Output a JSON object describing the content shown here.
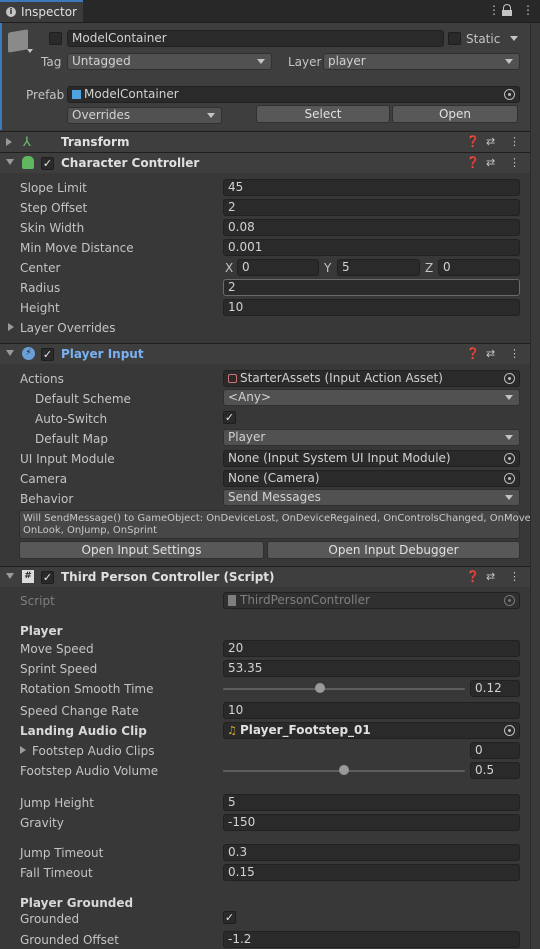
{
  "tab": {
    "title": "Inspector"
  },
  "object": {
    "name": "ModelContainer",
    "static_label": "Static",
    "tag_label": "Tag",
    "tag_value": "Untagged",
    "layer_label": "Layer",
    "layer_value": "player"
  },
  "prefab": {
    "label": "Prefab",
    "asset": "ModelContainer",
    "overrides": "Overrides",
    "select": "Select",
    "open": "Open"
  },
  "transform": {
    "title": "Transform"
  },
  "cc": {
    "title": "Character Controller",
    "slope_label": "Slope Limit",
    "slope": "45",
    "step_label": "Step Offset",
    "step": "2",
    "skin_label": "Skin Width",
    "skin": "0.08",
    "minmove_label": "Min Move Distance",
    "minmove": "0.001",
    "center_label": "Center",
    "cx_l": "X",
    "cx": "0",
    "cy_l": "Y",
    "cy": "5",
    "cz_l": "Z",
    "cz": "0",
    "radius_label": "Radius",
    "radius": "2",
    "height_label": "Height",
    "height": "10",
    "overrides_label": "Layer Overrides"
  },
  "pi": {
    "title": "Player Input",
    "actions_label": "Actions",
    "actions": "StarterAssets (Input Action Asset)",
    "scheme_label": "Default Scheme",
    "scheme": "<Any>",
    "autoswitch_label": "Auto-Switch",
    "map_label": "Default Map",
    "map": "Player",
    "uimodule_label": "UI Input Module",
    "uimodule": "None (Input System UI Input Module)",
    "camera_label": "Camera",
    "camera": "None (Camera)",
    "behavior_label": "Behavior",
    "behavior": "Send Messages",
    "info_line1": "Will SendMessage() to GameObject: OnDeviceLost, OnDeviceRegained, OnControlsChanged, OnMove,",
    "info_line2": "OnLook, OnJump, OnSprint",
    "open_settings": "Open Input Settings",
    "open_debugger": "Open Input Debugger"
  },
  "tpc": {
    "title": "Third Person Controller (Script)",
    "script_label": "Script",
    "script": "ThirdPersonController",
    "player_header": "Player",
    "move_label": "Move Speed",
    "move": "20",
    "sprint_label": "Sprint Speed",
    "sprint": "53.35",
    "rot_label": "Rotation Smooth Time",
    "rot": "0.12",
    "rot_fraction": 0.4,
    "speedchange_label": "Speed Change Rate",
    "speedchange": "10",
    "landing_label": "Landing Audio Clip",
    "landing": "Player_Footstep_01",
    "footclips_label": "Footstep Audio Clips",
    "footclips": "0",
    "footvol_label": "Footstep Audio Volume",
    "footvol": "0.5",
    "footvol_fraction": 0.5,
    "jumpheight_label": "Jump Height",
    "jumpheight": "5",
    "gravity_label": "Gravity",
    "gravity": "-150",
    "jumptimeout_label": "Jump Timeout",
    "jumptimeout": "0.3",
    "falltimeout_label": "Fall Timeout",
    "falltimeout": "0.15",
    "grounded_header": "Player Grounded",
    "grounded_label": "Grounded",
    "groundoff_label": "Grounded Offset",
    "groundoff": "-1.2"
  },
  "colors": {
    "background": "#383838",
    "accent": "#3a79bb",
    "field": "#2a2a2a",
    "header": "#3e3e3e"
  }
}
